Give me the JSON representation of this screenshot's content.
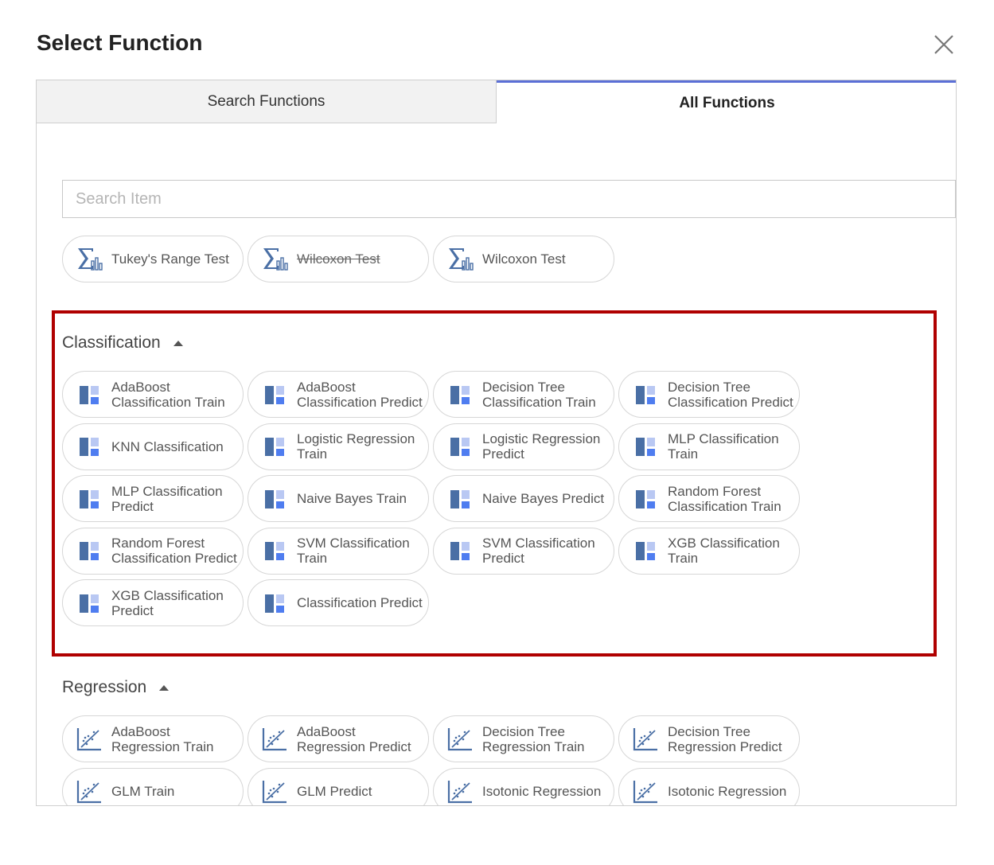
{
  "dialog": {
    "title": "Select Function"
  },
  "tabs": [
    {
      "label": "Search Functions",
      "active": false
    },
    {
      "label": "All Functions",
      "active": true
    }
  ],
  "search": {
    "placeholder": "Search Item",
    "value": ""
  },
  "recent_functions": [
    {
      "label": "Tukey's Range Test",
      "icon": "sigma-bar-chart-icon",
      "strikethrough": false
    },
    {
      "label": "Wilcoxon Test",
      "icon": "sigma-bar-chart-icon",
      "strikethrough": true
    },
    {
      "label": "Wilcoxon Test",
      "icon": "sigma-bar-chart-icon",
      "strikethrough": false
    }
  ],
  "sections": {
    "classification": {
      "title": "Classification",
      "icon": "classification-grid-icon",
      "items": [
        "AdaBoost\nClassification Train",
        "AdaBoost\nClassification Predict",
        "Decision Tree\nClassification Train",
        "Decision Tree\nClassification Predict",
        "KNN Classification",
        "Logistic Regression\nTrain",
        "Logistic Regression\nPredict",
        "MLP Classification\nTrain",
        "MLP Classification\nPredict",
        "Naive Bayes Train",
        "Naive Bayes Predict",
        "Random Forest\nClassification Train",
        "Random Forest\nClassification Predict",
        "SVM Classification\nTrain",
        "SVM Classification\nPredict",
        "XGB Classification\nTrain",
        "XGB Classification\nPredict",
        "Classification Predict"
      ]
    },
    "regression": {
      "title": "Regression",
      "icon": "regression-scatter-icon",
      "items": [
        "AdaBoost\nRegression Train",
        "AdaBoost\nRegression Predict",
        "Decision Tree\nRegression Train",
        "Decision Tree\nRegression Predict",
        "GLM Train",
        "GLM Predict",
        "Isotonic Regression",
        "Isotonic Regression"
      ]
    }
  },
  "colors": {
    "accent": "#5b6fd6",
    "highlight": "#b00000",
    "icon_dark": "#4a6fa5",
    "icon_light": "#b9c8f3",
    "icon_blue": "#4f7df0"
  }
}
